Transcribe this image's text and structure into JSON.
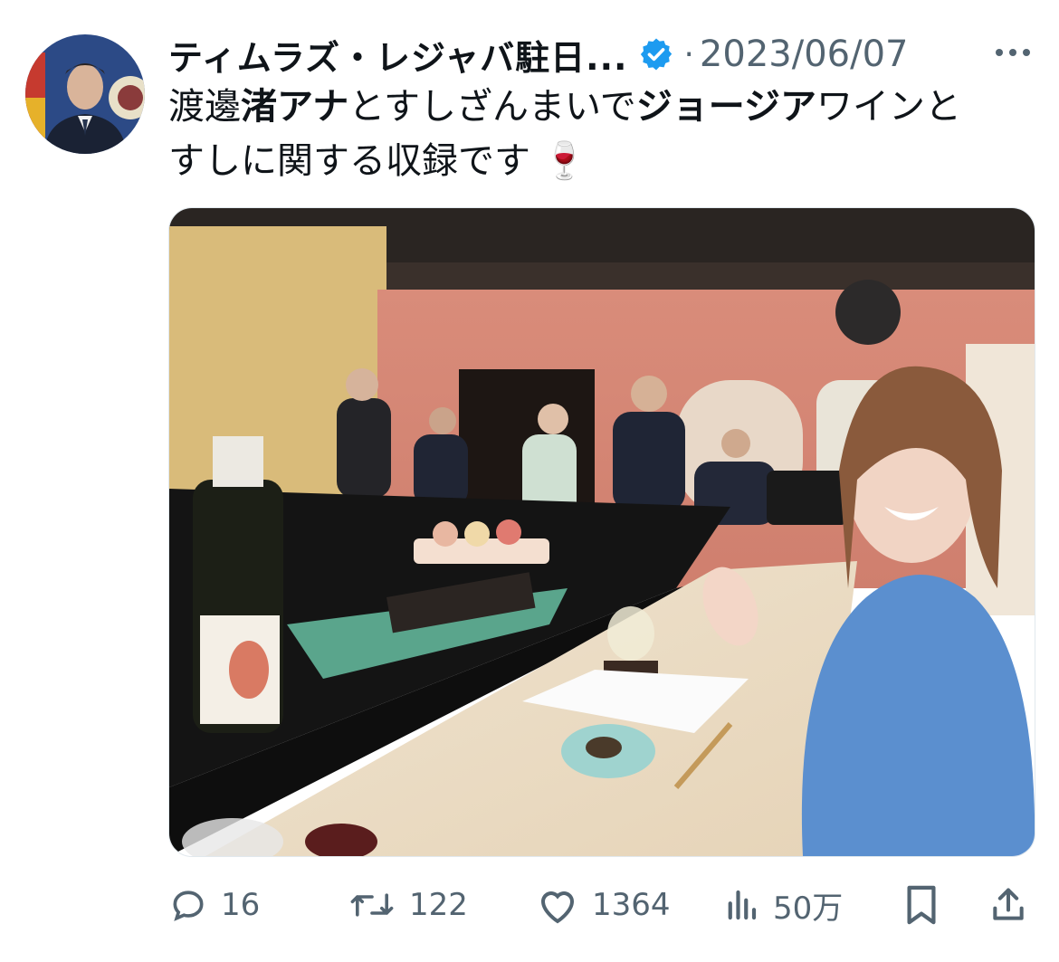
{
  "author": {
    "display_name": "ティムラズ・レジャバ駐日...",
    "verified": true,
    "date": "2023/06/07",
    "separator": "·"
  },
  "tweet": {
    "text_parts": [
      {
        "text": "渡邊",
        "bold": false
      },
      {
        "text": "渚アナ",
        "bold": true
      },
      {
        "text": "とすしざんまいで",
        "bold": false
      },
      {
        "text": "ジョージア",
        "bold": true
      },
      {
        "text": "ワインと",
        "bold": false
      },
      {
        "text": "すしに関する収録です",
        "bold": false
      },
      {
        "text": "🍷",
        "bold": false
      }
    ]
  },
  "media": {
    "alt": "寿司カウンターでワインボトルと笑顔の女性"
  },
  "actions": {
    "reply_count": "16",
    "retweet_count": "122",
    "like_count": "1364",
    "views_count": "50万"
  },
  "icons": {
    "verified": "verified-badge-icon",
    "more": "more-icon",
    "reply": "reply-icon",
    "retweet": "retweet-icon",
    "like": "heart-icon",
    "views": "views-icon",
    "bookmark": "bookmark-icon",
    "share": "share-icon"
  },
  "colors": {
    "accent": "#1d9bf0",
    "text": "#0f1419",
    "muted": "#536471"
  }
}
